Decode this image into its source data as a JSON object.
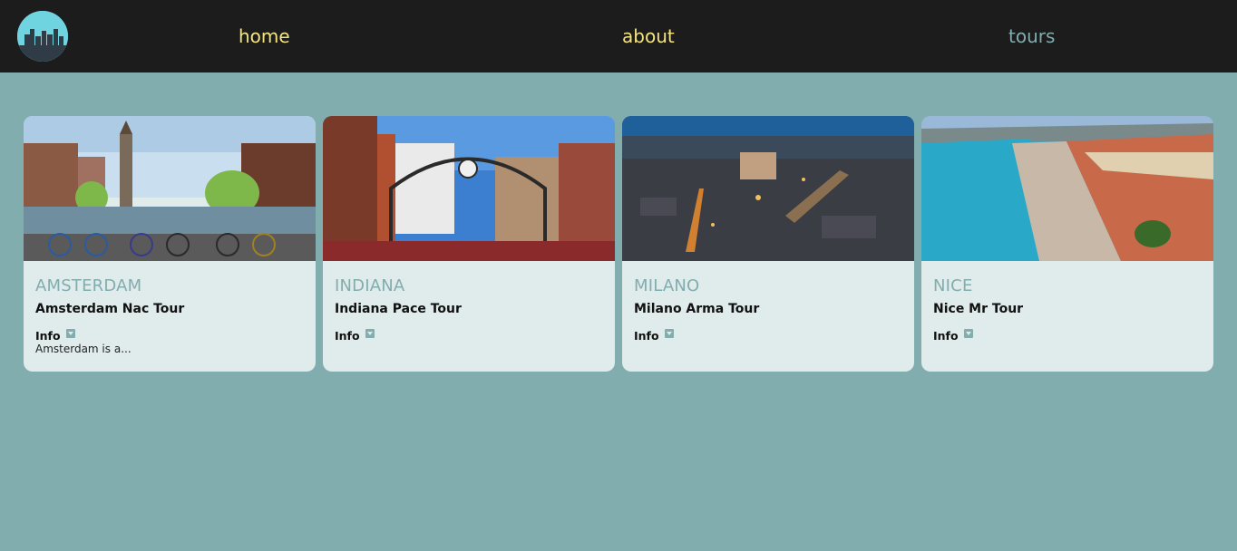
{
  "nav": {
    "logo_icon": "city-skyline-icon",
    "links": [
      {
        "label": "home",
        "color": "#f3e47d"
      },
      {
        "label": "about",
        "color": "#f3e47d"
      },
      {
        "label": "tours",
        "color": "#82adae"
      }
    ]
  },
  "colors": {
    "background": "#82adae",
    "navbar": "#1c1c1c",
    "card": "#e0ebeb",
    "accent": "#82adae",
    "nav_link": "#f3e47d"
  },
  "tours": [
    {
      "city": "AMSTERDAM",
      "name": "Amsterdam Nac Tour",
      "info_label": "Info",
      "info_text": "Amsterdam is a...",
      "image": "amsterdam-canal-photo"
    },
    {
      "city": "INDIANA",
      "name": "Indiana Pace Tour",
      "info_label": "Info",
      "info_text": "",
      "image": "indiana-street-photo"
    },
    {
      "city": "MILANO",
      "name": "Milano Arma Tour",
      "info_label": "Info",
      "info_text": "",
      "image": "milano-aerial-photo"
    },
    {
      "city": "NICE",
      "name": "Nice Mr Tour",
      "info_label": "Info",
      "info_text": "",
      "image": "nice-beach-photo"
    }
  ]
}
